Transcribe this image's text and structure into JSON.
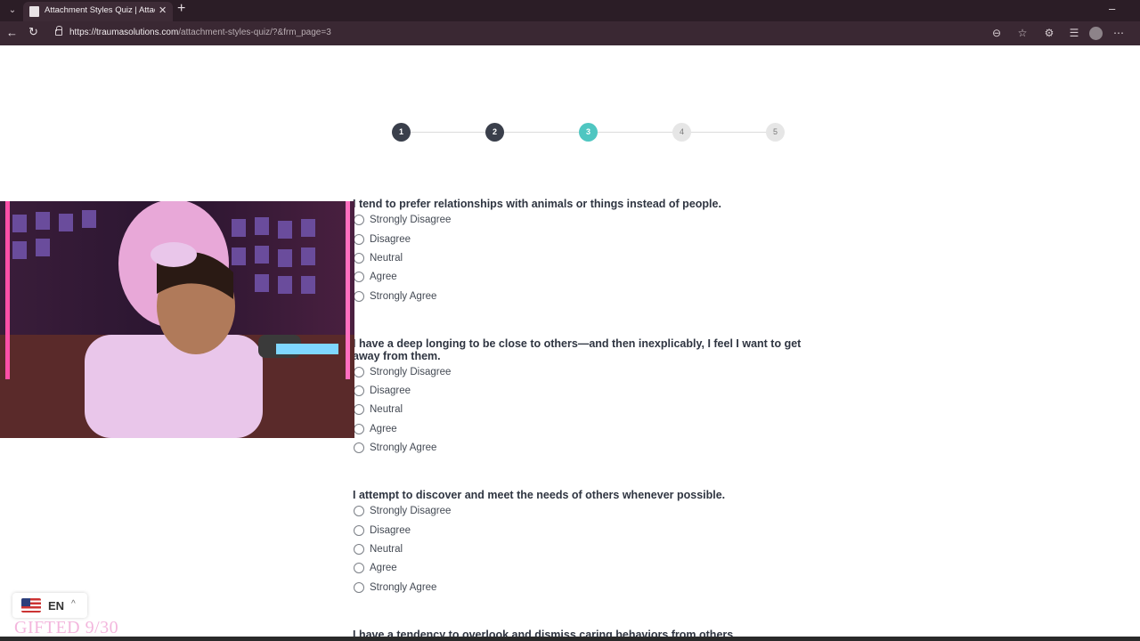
{
  "browser": {
    "tab_title": "Attachment Styles Quiz | Attachm",
    "url_host": "https://traumasolutions.com",
    "url_path": "/attachment-styles-quiz/?&frm_page=3"
  },
  "stepper": {
    "steps": [
      {
        "label": "1",
        "state": "done"
      },
      {
        "label": "2",
        "state": "done"
      },
      {
        "label": "3",
        "state": "current"
      },
      {
        "label": "4",
        "state": "todo"
      },
      {
        "label": "5",
        "state": "todo"
      }
    ],
    "colors": {
      "done": "#3a3f4b",
      "current": "#4fc6c1",
      "todo": "#e6e6e6"
    }
  },
  "questions": [
    {
      "text": "I tend to prefer relationships with animals or things instead of people.",
      "options": [
        "Strongly Disagree",
        "Disagree",
        "Neutral",
        "Agree",
        "Strongly Agree"
      ]
    },
    {
      "text": "I have a deep longing to be close to others—and then inexplicably, I feel I want to get away from them.",
      "options": [
        "Strongly Disagree",
        "Disagree",
        "Neutral",
        "Agree",
        "Strongly Agree"
      ]
    },
    {
      "text": "I attempt to discover and meet the needs of others whenever possible.",
      "options": [
        "Strongly Disagree",
        "Disagree",
        "Neutral",
        "Agree",
        "Strongly Agree"
      ]
    },
    {
      "text": "I have a tendency to overlook and dismiss caring behaviors from others."
    }
  ],
  "language": {
    "code": "EN",
    "flag": "us-flag-icon"
  },
  "overlay": {
    "gifted_text": "GIFTED 9/30"
  }
}
